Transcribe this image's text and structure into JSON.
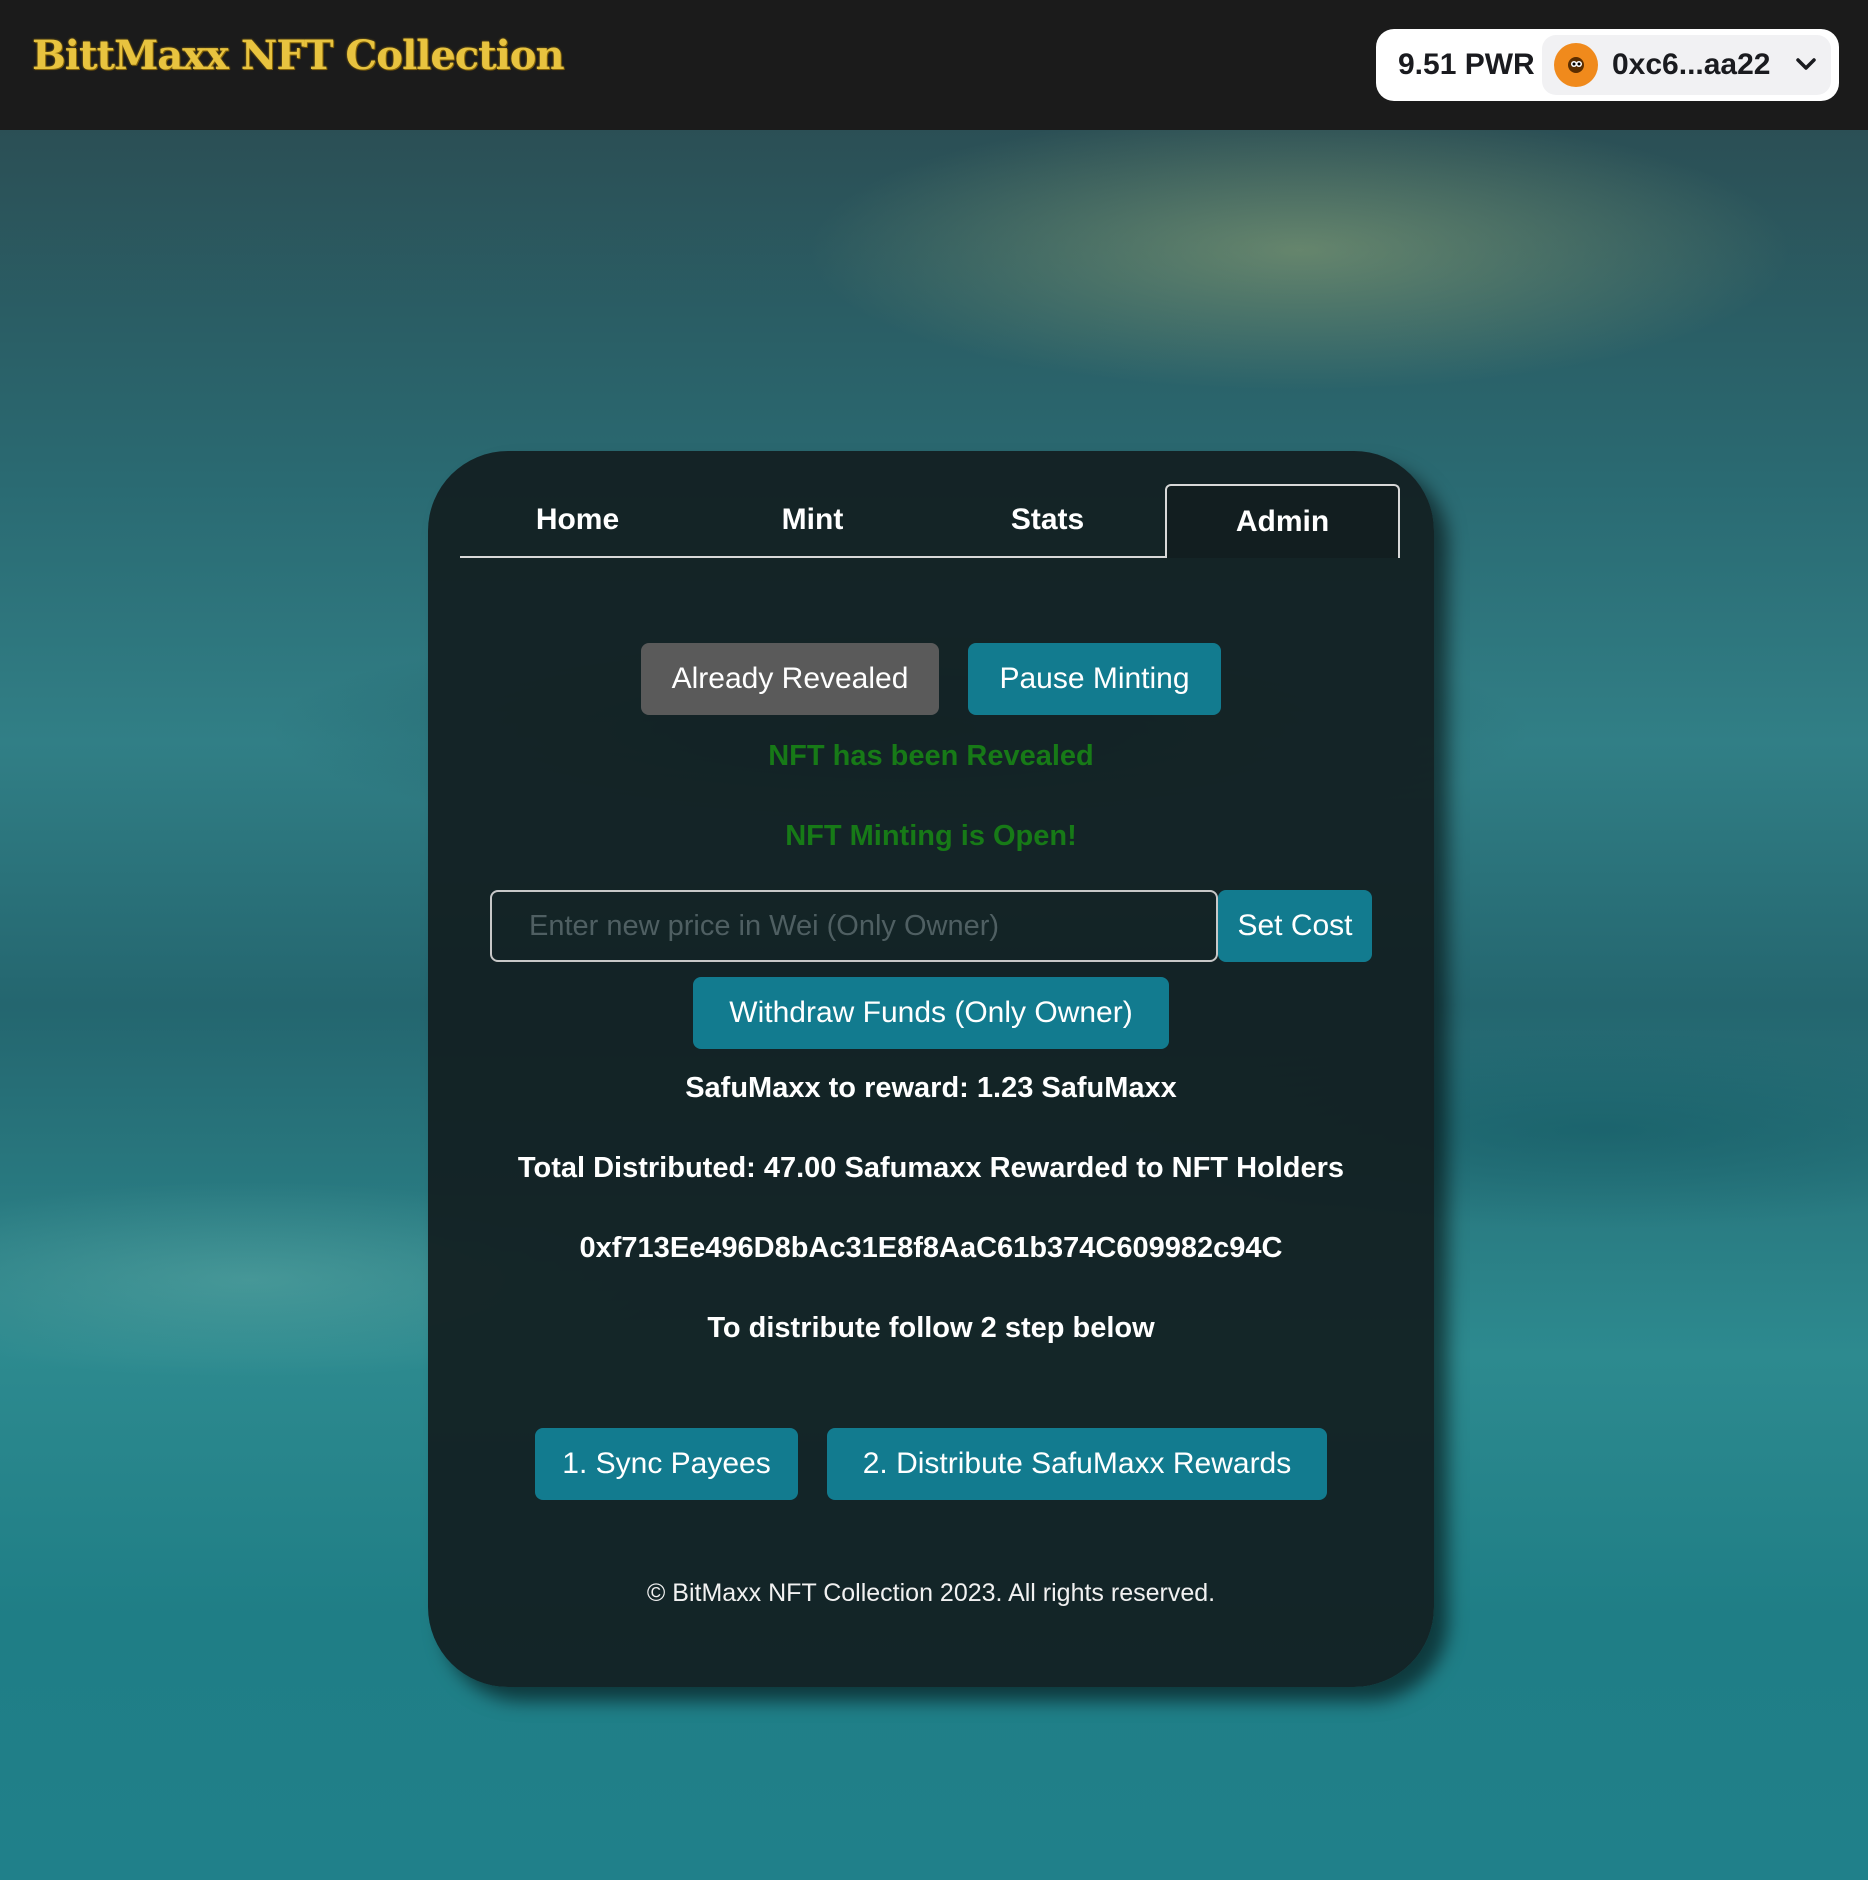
{
  "header": {
    "logo_text": "BittMaxx NFT Collection",
    "balance": "9.51 PWR",
    "address": "0xc6...aa22"
  },
  "tabs": [
    {
      "label": "Home",
      "active": false
    },
    {
      "label": "Mint",
      "active": false
    },
    {
      "label": "Stats",
      "active": false
    },
    {
      "label": "Admin",
      "active": true
    }
  ],
  "admin": {
    "reveal_button": "Already Revealed",
    "pause_button": "Pause Minting",
    "reveal_status": "NFT has been Revealed",
    "minting_status": "NFT Minting is Open!",
    "price_placeholder": "Enter new price in Wei (Only Owner)",
    "set_cost_button": "Set Cost",
    "withdraw_button": "Withdraw Funds (Only Owner)",
    "reward_text": "SafuMaxx to reward: 1.23 SafuMaxx",
    "distributed_text": "Total Distributed: 47.00 Safumaxx Rewarded to NFT Holders",
    "contract_address": "0xf713Ee496D8bAc31E8f8AaC61b374C609982c94C",
    "instructions": "To distribute follow 2 step below",
    "sync_button": "1. Sync Payees",
    "distribute_button": "2. Distribute SafuMaxx Rewards"
  },
  "footer": {
    "copyright": "© BitMaxx NFT Collection 2023. All rights reserved."
  },
  "colors": {
    "accent": "#127b8f",
    "disabled": "#5a5a5a",
    "status_green": "#177a17",
    "logo_gold": "#e8c33f"
  }
}
